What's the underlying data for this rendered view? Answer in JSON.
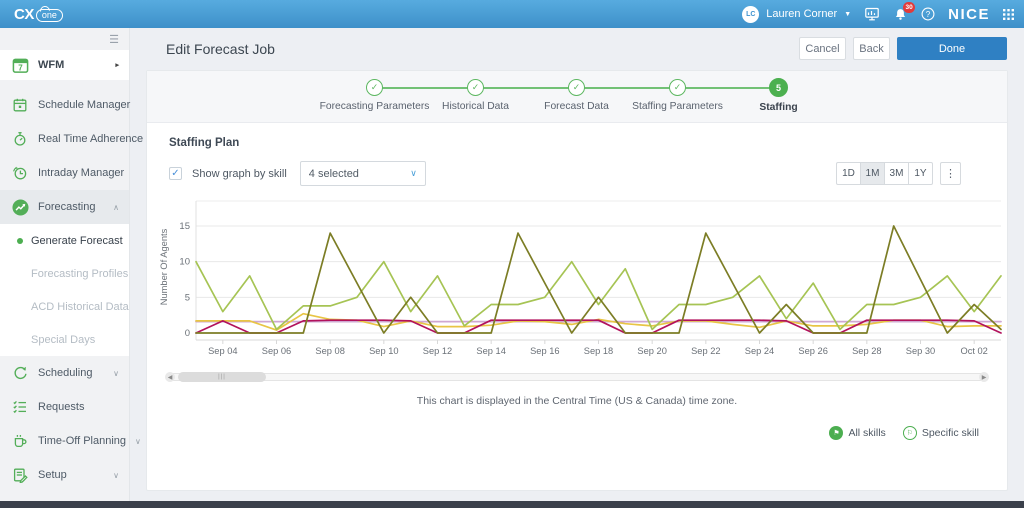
{
  "topbar": {
    "logo_cx": "CX",
    "logo_one": "one",
    "user_initials": "LC",
    "user_name": "Lauren Corner",
    "notification_count": "30",
    "brand": "NICE"
  },
  "sidebar": {
    "items": [
      {
        "label": "WFM",
        "icon": "wfm-calendar-icon",
        "kind": "app"
      },
      {
        "label": "Schedule Manager",
        "icon": "calendar-icon",
        "kind": "item"
      },
      {
        "label": "Real Time Adherence",
        "icon": "stopwatch-icon",
        "kind": "item"
      },
      {
        "label": "Intraday Manager",
        "icon": "clock-icon",
        "kind": "item"
      },
      {
        "label": "Forecasting",
        "icon": "trend-icon",
        "kind": "item",
        "selected": true,
        "chevron": "up"
      },
      {
        "label": "Generate Forecast",
        "kind": "sub",
        "active": true
      },
      {
        "label": "Forecasting Profiles",
        "kind": "sub"
      },
      {
        "label": "ACD Historical Data",
        "kind": "sub"
      },
      {
        "label": "Special Days",
        "kind": "sub"
      },
      {
        "label": "Scheduling",
        "icon": "refresh-icon",
        "kind": "item",
        "chevron": "down"
      },
      {
        "label": "Requests",
        "icon": "checklist-icon",
        "kind": "item"
      },
      {
        "label": "Time-Off Planning",
        "icon": "cup-icon",
        "kind": "item",
        "chevron": "down"
      },
      {
        "label": "Setup",
        "icon": "doc-pencil-icon",
        "kind": "item",
        "chevron": "down"
      }
    ]
  },
  "header": {
    "title": "Edit Forecast Job",
    "cancel_label": "Cancel",
    "back_label": "Back",
    "done_label": "Done"
  },
  "stepper": {
    "steps": [
      {
        "label": "Forecasting Parameters",
        "state": "done"
      },
      {
        "label": "Historical Data",
        "state": "done"
      },
      {
        "label": "Forecast Data",
        "state": "done"
      },
      {
        "label": "Staffing Parameters",
        "state": "done"
      },
      {
        "label": "Staffing",
        "state": "current",
        "number": "5"
      }
    ]
  },
  "staffing": {
    "section_title": "Staffing Plan",
    "show_graph_label": "Show graph by skill",
    "checkbox_checked": true,
    "skills_selected": "4 selected",
    "range_buttons": [
      "1D",
      "1M",
      "3M",
      "1Y"
    ],
    "range_selected": "1M"
  },
  "chart_data": {
    "type": "line",
    "title": "",
    "xlabel": "",
    "ylabel": "Number Of Agents",
    "ylim": [
      0,
      18
    ],
    "yticks": [
      0,
      5,
      10,
      15
    ],
    "grid": true,
    "legend_position": "none",
    "x": [
      "Sep 03",
      "Sep 04",
      "Sep 05",
      "Sep 06",
      "Sep 07",
      "Sep 08",
      "Sep 09",
      "Sep 10",
      "Sep 11",
      "Sep 12",
      "Sep 13",
      "Sep 14",
      "Sep 15",
      "Sep 16",
      "Sep 17",
      "Sep 18",
      "Sep 19",
      "Sep 20",
      "Sep 21",
      "Sep 22",
      "Sep 23",
      "Sep 24",
      "Sep 25",
      "Sep 26",
      "Sep 27",
      "Sep 28",
      "Sep 29",
      "Sep 30",
      "Oct 01",
      "Oct 02",
      "Oct 03"
    ],
    "x_tick_labels": [
      "Sep 04",
      "Sep 06",
      "Sep 08",
      "Sep 10",
      "Sep 12",
      "Sep 14",
      "Sep 16",
      "Sep 18",
      "Sep 20",
      "Sep 22",
      "Sep 24",
      "Sep 26",
      "Sep 28",
      "Sep 30",
      "Oct 02"
    ],
    "x_tick_step": 2,
    "series": [
      {
        "name": "skill-violet",
        "color": "#cfa8d2",
        "values": [
          1.6,
          1.6,
          1.6,
          1.6,
          1.6,
          1.6,
          1.6,
          1.6,
          1.6,
          1.6,
          1.6,
          1.6,
          1.6,
          1.6,
          1.6,
          1.6,
          1.6,
          1.6,
          1.6,
          1.6,
          1.6,
          1.6,
          1.6,
          1.6,
          1.6,
          1.6,
          1.6,
          1.6,
          1.6,
          1.6,
          1.6
        ]
      },
      {
        "name": "skill-gold",
        "color": "#e8c545",
        "values": [
          1.7,
          1.7,
          1.7,
          0.4,
          2.7,
          1.9,
          1.8,
          0.9,
          1.7,
          0.9,
          0.9,
          1.1,
          1.7,
          1.6,
          1.2,
          1.9,
          1.3,
          1.0,
          1.7,
          1.7,
          1.2,
          0.8,
          1.7,
          1.0,
          1.0,
          1.2,
          1.8,
          1.8,
          0.9,
          1.0,
          1.0
        ]
      },
      {
        "name": "skill-lightgreen",
        "color": "#a6c454",
        "values": [
          10,
          3,
          8,
          0.5,
          3.8,
          3.8,
          5,
          10,
          3,
          8,
          1,
          4,
          4,
          5,
          10,
          4,
          9,
          0.5,
          4,
          4,
          5,
          8,
          2,
          7,
          0.5,
          4,
          4,
          5,
          8,
          3,
          8
        ]
      },
      {
        "name": "skill-crimson",
        "color": "#b2125c",
        "values": [
          0,
          1.7,
          0,
          0,
          1.7,
          1.8,
          1.8,
          1.8,
          1.7,
          0,
          0,
          1.8,
          1.8,
          1.8,
          1.8,
          1.8,
          0,
          0,
          1.8,
          1.8,
          1.8,
          1.8,
          1.7,
          0,
          0,
          1.8,
          1.8,
          1.8,
          1.8,
          1.7,
          0
        ]
      },
      {
        "name": "skill-olive",
        "color": "#7c7d25",
        "values": [
          0,
          0,
          0,
          0,
          0,
          14,
          7,
          0,
          5,
          0,
          0,
          0,
          14,
          7,
          0,
          5,
          0,
          0,
          0,
          14,
          7,
          0,
          4,
          0,
          0,
          0,
          15,
          7.5,
          0,
          4,
          0.5
        ]
      }
    ]
  },
  "footer": {
    "timezone_note": "This chart is displayed in the Central Time (US & Canada) time zone.",
    "legend": [
      {
        "label": "All skills",
        "style": "filled"
      },
      {
        "label": "Specific skill",
        "style": "outline"
      }
    ]
  },
  "colors": {
    "accent_green": "#4cae50",
    "accent_blue": "#2f80c3",
    "badge_red": "#e23b3b"
  }
}
